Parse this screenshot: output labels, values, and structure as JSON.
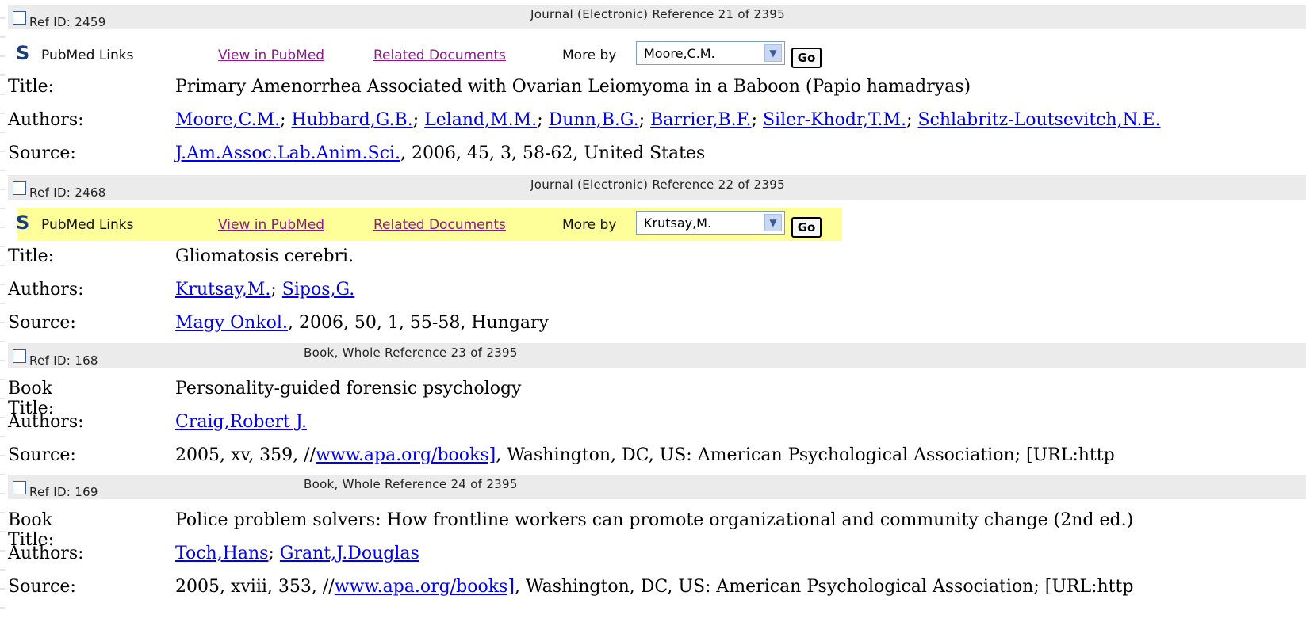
{
  "common": {
    "pubmed_label": "PubMed Links",
    "view_label": "View in PubMed",
    "related_label": "Related Documents",
    "moreby_label": "More by",
    "go_label": "Go",
    "title_key": "Title:",
    "book_title_key": "Book Title:",
    "authors_key": "Authors:",
    "source_key": "Source:",
    "sep": "; ",
    "pubmed_icon": "pubmed-s-icon",
    "highlight_color": "#ffff99"
  },
  "refs": [
    {
      "refid": "Ref ID: 2459",
      "type": "Journal (Electronic) Reference 21 of 2395",
      "more_by": "Moore,C.M.",
      "title": "Primary Amenorrhea Associated with Ovarian Leiomyoma in a Baboon (Papio hamadryas)",
      "authors": [
        "Moore,C.M.",
        "Hubbard,G.B.",
        "Leland,M.M.",
        "Dunn,B.G.",
        "Barrier,B.F.",
        "Siler-Khodr,T.M.",
        "Schlabritz-Loutsevitch,N.E."
      ],
      "source_link": "J.Am.Assoc.Lab.Anim.Sci.",
      "source_rest": ", 2006, 45, 3, 58-62, United States"
    },
    {
      "refid": "Ref ID: 2468",
      "type": "Journal (Electronic) Reference 22 of 2395",
      "more_by": "Krutsay,M.",
      "title": "Gliomatosis cerebri.",
      "authors": [
        "Krutsay,M.",
        "Sipos,G."
      ],
      "source_link": "Magy Onkol.",
      "source_rest": ", 2006, 50, 1, 55-58, Hungary"
    },
    {
      "refid": "Ref ID: 168",
      "type": "Book, Whole Reference 23 of 2395",
      "book_title": "Personality-guided forensic psychology",
      "authors": [
        "Craig,Robert J."
      ],
      "source_pre": "2005, xv, 359, //",
      "source_link": "www.apa.org/books]",
      "source_rest": ", Washington, DC, US: American Psychological Association; [URL:http"
    },
    {
      "refid": "Ref ID: 169",
      "type": "Book, Whole Reference 24 of 2395",
      "book_title": "Police problem solvers: How frontline workers can promote organizational and community change (2nd ed.)",
      "authors": [
        "Toch,Hans",
        "Grant,J.Douglas"
      ],
      "source_pre": "2005, xviii, 353, //",
      "source_link": "www.apa.org/books]",
      "source_rest": ", Washington, DC, US: American Psychological Association; [URL:http"
    }
  ]
}
